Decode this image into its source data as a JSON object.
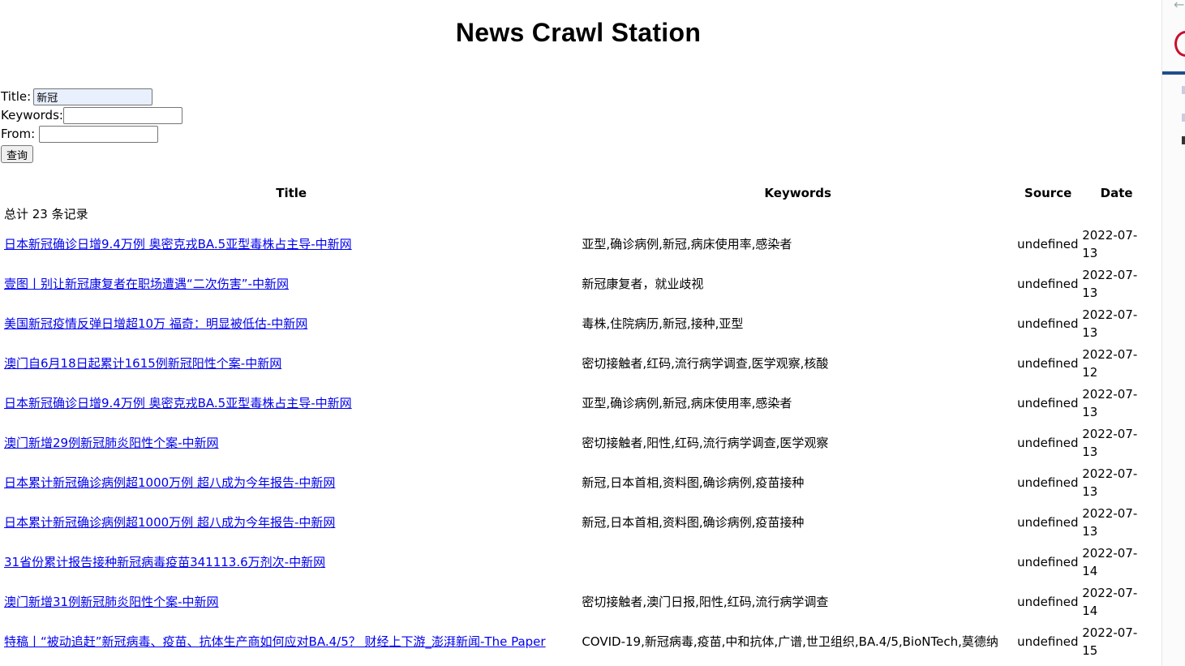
{
  "page": {
    "heading": "News Crawl Station"
  },
  "form": {
    "title_label": "Title:",
    "title_value": "新冠",
    "keywords_label": "Keywords:",
    "keywords_value": "",
    "from_label": "From:",
    "from_value": "",
    "submit_label": "查询"
  },
  "table": {
    "headers": {
      "title": "Title",
      "keywords": "Keywords",
      "source": "Source",
      "date": "Date"
    },
    "total_text": "总计 23 条记录",
    "rows": [
      {
        "title": "日本新冠确诊日增9.4万例 奥密克戎BA.5亚型毒株占主导-中新网",
        "keywords": "亚型,确诊病例,新冠,病床使用率,感染者",
        "source": "undefined",
        "date": "2022-07-13"
      },
      {
        "title": "壹图丨别让新冠康复者在职场遭遇“二次伤害”-中新网",
        "keywords": "新冠康复者，就业歧视",
        "source": "undefined",
        "date": "2022-07-13"
      },
      {
        "title": "美国新冠疫情反弹日增超10万 福奇：明显被低估-中新网",
        "keywords": "毒株,住院病历,新冠,接种,亚型",
        "source": "undefined",
        "date": "2022-07-13"
      },
      {
        "title": "澳门自6月18日起累计1615例新冠阳性个案-中新网",
        "keywords": "密切接触者,红码,流行病学调查,医学观察,核酸",
        "source": "undefined",
        "date": "2022-07-12"
      },
      {
        "title": "日本新冠确诊日增9.4万例 奥密克戎BA.5亚型毒株占主导-中新网",
        "keywords": "亚型,确诊病例,新冠,病床使用率,感染者",
        "source": "undefined",
        "date": "2022-07-13"
      },
      {
        "title": "澳门新增29例新冠肺炎阳性个案-中新网",
        "keywords": "密切接触者,阳性,红码,流行病学调查,医学观察",
        "source": "undefined",
        "date": "2022-07-13"
      },
      {
        "title": "日本累计新冠确诊病例超1000万例 超八成为今年报告-中新网",
        "keywords": "新冠,日本首相,资料图,确诊病例,疫苗接种",
        "source": "undefined",
        "date": "2022-07-13"
      },
      {
        "title": "日本累计新冠确诊病例超1000万例 超八成为今年报告-中新网",
        "keywords": "新冠,日本首相,资料图,确诊病例,疫苗接种",
        "source": "undefined",
        "date": "2022-07-13"
      },
      {
        "title": "31省份累计报告接种新冠病毒疫苗341113.6万剂次-中新网",
        "keywords": "",
        "source": "undefined",
        "date": "2022-07-14"
      },
      {
        "title": "澳门新增31例新冠肺炎阳性个案-中新网",
        "keywords": "密切接触者,澳门日报,阳性,红码,流行病学调查",
        "source": "undefined",
        "date": "2022-07-14"
      },
      {
        "title": "特稿丨“被动追赶”新冠病毒、疫苗、抗体生产商如何应对BA.4/5？ 财经上下游_澎湃新闻-The Paper",
        "keywords": "COVID-19,新冠病毒,疫苗,中和抗体,广谱,世卫组织,BA.4/5,BioNTech,莫德纳",
        "source": "undefined",
        "date": "2022-07-15"
      }
    ]
  },
  "icons": {
    "back_arrow": "back-arrow-icon",
    "site_logo": "site-logo-icon"
  }
}
